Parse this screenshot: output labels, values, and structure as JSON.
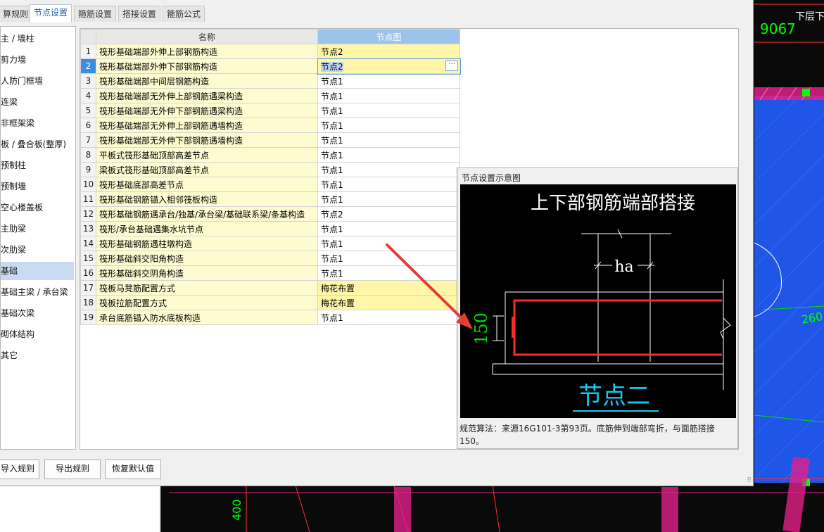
{
  "tabs": [
    "算规则",
    "节点设置",
    "箍筋设置",
    "搭接设置",
    "箍筋公式"
  ],
  "active_tab": 1,
  "sidebar": {
    "items": [
      "主 / 墙柱",
      "剪力墙",
      "人防门框墙",
      "连梁",
      "非框架梁",
      "板 / 叠合板(整厚)",
      "预制柱",
      "预制墙",
      "空心楼盖板",
      "主肋梁",
      "次肋梁",
      "基础",
      "基础主梁 / 承台梁",
      "基础次梁",
      "砌体结构",
      "其它"
    ],
    "selected": 11
  },
  "table": {
    "headers": {
      "name": "名称",
      "node": "节点图"
    },
    "rows": [
      {
        "num": "1",
        "name": "筏形基础端部外伸上部钢筋构造",
        "value": "节点2"
      },
      {
        "num": "2",
        "name": "筏形基础端部外伸下部钢筋构造",
        "value": "节点2"
      },
      {
        "num": "3",
        "name": "筏形基础端部中间层钢筋构造",
        "value": "节点1"
      },
      {
        "num": "4",
        "name": "筏形基础端部无外伸上部钢筋遇梁构造",
        "value": "节点1"
      },
      {
        "num": "5",
        "name": "筏形基础端部无外伸下部钢筋遇梁构造",
        "value": "节点1"
      },
      {
        "num": "6",
        "name": "筏形基础端部无外伸上部钢筋遇墙构造",
        "value": "节点1"
      },
      {
        "num": "7",
        "name": "筏形基础端部无外伸下部钢筋遇墙构造",
        "value": "节点1"
      },
      {
        "num": "8",
        "name": "平板式筏形基础顶部高差节点",
        "value": "节点1"
      },
      {
        "num": "9",
        "name": "梁板式筏形基础顶部高差节点",
        "value": "节点1"
      },
      {
        "num": "10",
        "name": "筏形基础底部高差节点",
        "value": "节点1"
      },
      {
        "num": "11",
        "name": "筏形基础钢筋锚入相邻筏板构造",
        "value": "节点1"
      },
      {
        "num": "12",
        "name": "筏形基础钢筋遇承台/独基/承台梁/基础联系梁/条基构造",
        "value": "节点2"
      },
      {
        "num": "13",
        "name": "筏形/承台基础遇集水坑节点",
        "value": "节点1"
      },
      {
        "num": "14",
        "name": "筏形基础钢筋遇柱墩构造",
        "value": "节点1"
      },
      {
        "num": "15",
        "name": "筏形基础斜交阳角构造",
        "value": "节点1"
      },
      {
        "num": "16",
        "name": "筏形基础斜交阴角构造",
        "value": "节点1"
      },
      {
        "num": "17",
        "name": "筏板马凳筋配置方式",
        "value": "梅花布置"
      },
      {
        "num": "18",
        "name": "筏板拉筋配置方式",
        "value": "梅花布置"
      },
      {
        "num": "19",
        "name": "承台底筋锚入防水底板构造",
        "value": "节点1"
      }
    ],
    "selected_row": 1,
    "highlighted_rows": [
      0,
      1,
      16,
      17
    ]
  },
  "preview": {
    "title": "节点设置示意图",
    "diagram_title": "上下部钢筋端部搭接",
    "dim_ha": "ha",
    "dim_150": "150",
    "node_label": "节点二",
    "description": "规范算法：来源16G101-3第93页。底筋伸到端部弯折，与面筋搭接150。"
  },
  "buttons": {
    "import": "导入规则",
    "export": "导出规则",
    "restore": "恢复默认值"
  },
  "cad": {
    "text_9067": "9067",
    "text_top": "下层下排",
    "text_260": "260",
    "text_400": "400"
  },
  "colors": {
    "accent": "#3c8fe0",
    "header_node": "#9cc4ea",
    "name_cell": "#fffbd0",
    "highlight_cell": "#fff6a8",
    "cad_blue": "#1f56e8",
    "cad_magenta": "#e0208a",
    "cad_green": "#00ff00"
  }
}
